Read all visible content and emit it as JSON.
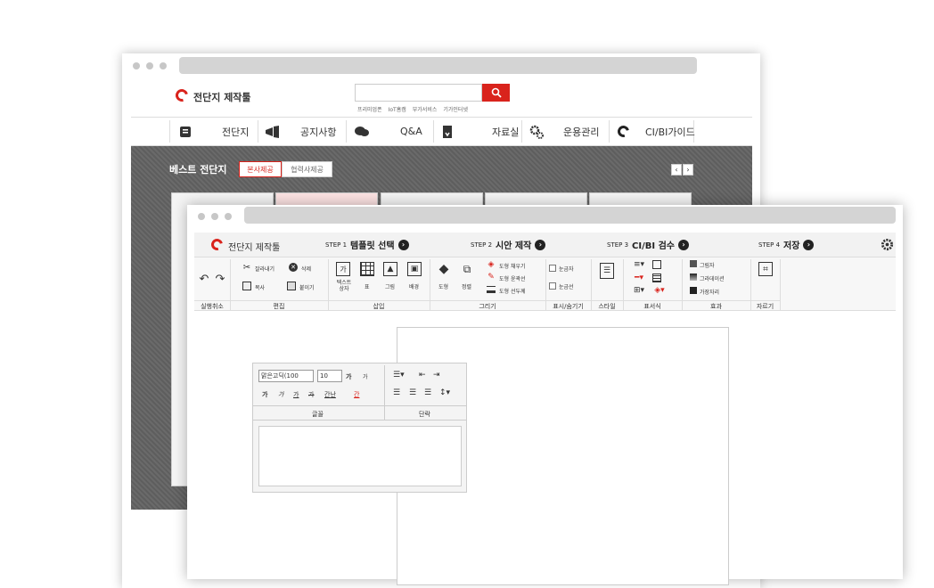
{
  "back": {
    "logo": "전단지 제작툴",
    "search": {
      "placeholder": ""
    },
    "keywords": [
      "프리미엄폰",
      "IoT홈캠",
      "부가서비스",
      "기가인터넷"
    ],
    "nav": [
      "전단지",
      "공지사항",
      "Q&A",
      "자료실",
      "운용관리",
      "CI/BI가이드"
    ],
    "hero": {
      "title": "베스트 전단지",
      "tabs": [
        "본사제공",
        "협력사제공"
      ],
      "prev": "‹",
      "next": "›"
    }
  },
  "front": {
    "logo": "전단지 제작툴",
    "steps": [
      {
        "num": "STEP 1",
        "label": "템플릿 선택"
      },
      {
        "num": "STEP 2",
        "label": "시안 제작"
      },
      {
        "num": "STEP 3",
        "label": "CI/BI 검수"
      },
      {
        "num": "STEP 4",
        "label": "저장"
      }
    ],
    "ribbon": {
      "groups": [
        "실행취소",
        "편집",
        "삽입",
        "그리기",
        "표시/숨기기",
        "스타일",
        "표서식",
        "효과",
        "자르기"
      ],
      "edit": {
        "cut": "잘라내기",
        "delete": "삭제",
        "copy": "복사",
        "paste": "붙이기"
      },
      "insert": {
        "textbox": "텍스트\n상자",
        "table": "표",
        "image": "그림",
        "background": "배경"
      },
      "draw": {
        "shape": "도형",
        "align": "정렬",
        "fill": "도형 채우기",
        "outline": "도형 윤곽선",
        "stroke": "도형 선두께"
      },
      "show": {
        "ruler": "눈금자",
        "grid": "눈금선"
      },
      "effect": {
        "shadow": "그림자",
        "gradient": "그라데이션",
        "edge": "가장자리"
      }
    },
    "font_panel": {
      "font": "맑은고딕(100",
      "size": "10",
      "grow": "가",
      "shrink": "가",
      "styles": [
        "가",
        "가",
        "가",
        "가"
      ],
      "spacing": "간난",
      "color": "간",
      "font_label": "글꼴",
      "para_label": "단락"
    }
  }
}
